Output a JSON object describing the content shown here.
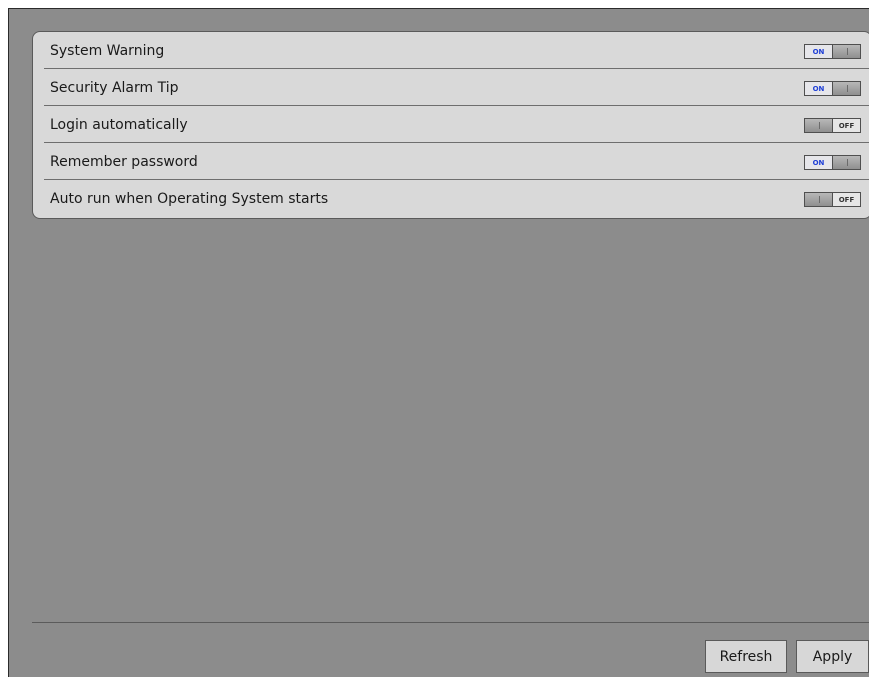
{
  "settings": [
    {
      "label": "System Warning",
      "state": "on",
      "on_text": "ON",
      "off_text": ""
    },
    {
      "label": "Security Alarm Tip",
      "state": "on",
      "on_text": "ON",
      "off_text": ""
    },
    {
      "label": "Login automatically",
      "state": "off",
      "on_text": "",
      "off_text": "OFF"
    },
    {
      "label": "Remember password",
      "state": "on",
      "on_text": "ON",
      "off_text": ""
    },
    {
      "label": "Auto run when Operating System starts",
      "state": "off",
      "on_text": "",
      "off_text": "OFF"
    }
  ],
  "footer": {
    "refresh_label": "Refresh",
    "apply_label": "Apply"
  }
}
